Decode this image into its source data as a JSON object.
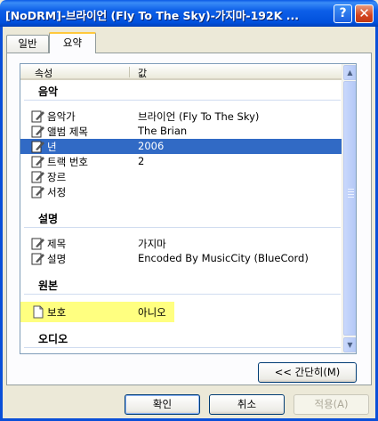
{
  "window": {
    "title": "[NoDRM]-브라이언 (Fly To The Sky)-가지마-192K ..."
  },
  "tabs": [
    {
      "label": "일반"
    },
    {
      "label": "요약"
    }
  ],
  "list": {
    "columns": {
      "property": "속성",
      "value": "값"
    },
    "groups": {
      "music": "음악",
      "description": "설명",
      "source": "원본",
      "audio": "오디오"
    },
    "music_rows": [
      {
        "key": "음악가",
        "value": "브라이언 (Fly To The Sky)"
      },
      {
        "key": "앨범 제목",
        "value": "The Brian"
      },
      {
        "key": "년",
        "value": "2006"
      },
      {
        "key": "트랙 번호",
        "value": "2"
      },
      {
        "key": "장르",
        "value": ""
      },
      {
        "key": "서정",
        "value": ""
      }
    ],
    "description_rows": [
      {
        "key": "제목",
        "value": "가지마"
      },
      {
        "key": "설명",
        "value": "Encoded By MusicCity (BlueCord)"
      }
    ],
    "source_rows": [
      {
        "key": "보호",
        "value": "아니오"
      }
    ]
  },
  "buttons": {
    "simple": "<< 간단히(M)",
    "ok": "확인",
    "cancel": "취소",
    "apply": "적용(A)"
  },
  "colors": {
    "titlebar": "#0d5fe8",
    "selection": "#316ac5",
    "highlight": "#ffff80"
  }
}
